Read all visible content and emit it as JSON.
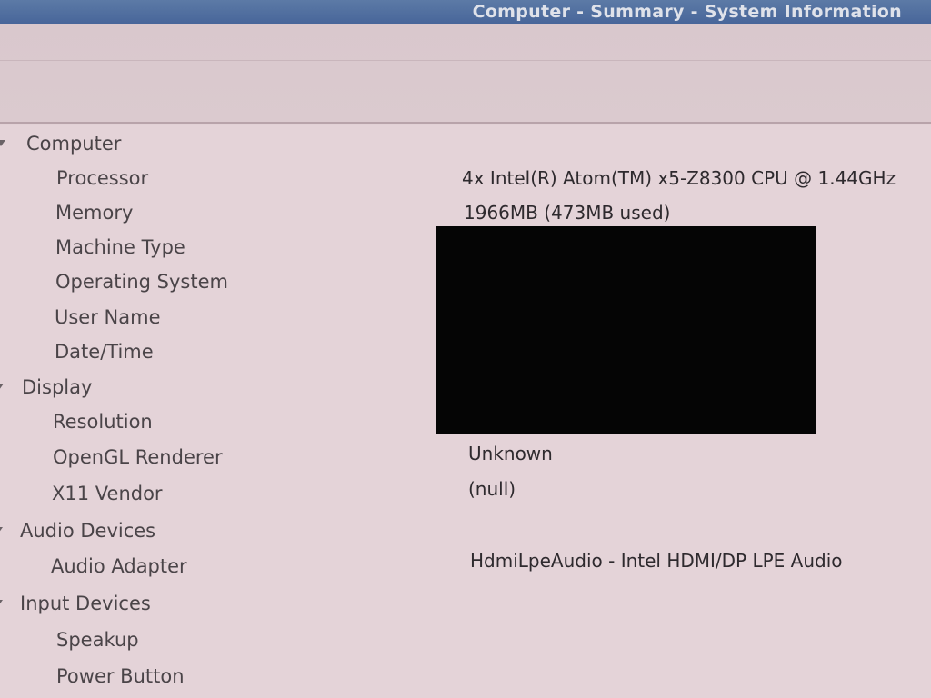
{
  "window": {
    "title": "Computer - Summary - System Information"
  },
  "tree": {
    "groups": [
      {
        "label": "Computer",
        "items": [
          {
            "label": "Processor",
            "value": "4x Intel(R) Atom(TM) x5-Z8300  CPU @ 1.44GHz"
          },
          {
            "label": "Memory",
            "value": "1966MB (473MB used)"
          },
          {
            "label": "Machine Type",
            "value": ""
          },
          {
            "label": "Operating System",
            "value": ""
          },
          {
            "label": "User Name",
            "value": ""
          },
          {
            "label": "Date/Time",
            "value": ""
          }
        ]
      },
      {
        "label": "Display",
        "items": [
          {
            "label": "Resolution",
            "value": ""
          },
          {
            "label": "OpenGL Renderer",
            "value": "Unknown"
          },
          {
            "label": "X11 Vendor",
            "value": "(null)"
          }
        ]
      },
      {
        "label": "Audio Devices",
        "items": [
          {
            "label": "Audio Adapter",
            "value": "HdmiLpeAudio - Intel HDMI/DP LPE Audio"
          }
        ]
      },
      {
        "label": "Input Devices",
        "items": [
          {
            "label": "Speakup",
            "value": ""
          },
          {
            "label": "Power Button",
            "value": ""
          }
        ]
      }
    ]
  }
}
